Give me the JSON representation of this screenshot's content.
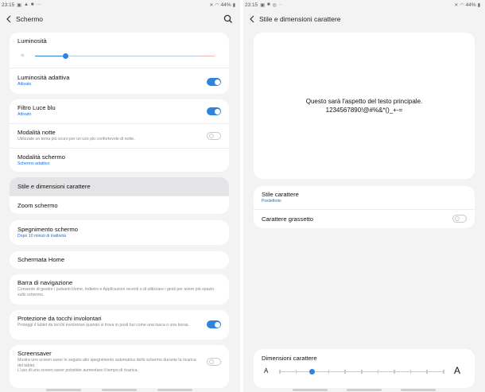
{
  "left": {
    "status": {
      "time": "23:15",
      "battery": "44%",
      "icons": [
        "gallery-icon",
        "warning-icon",
        "photo-icon",
        "more-icon"
      ]
    },
    "header": {
      "title": "Schermo"
    },
    "brightness": {
      "label": "Luminosità",
      "level": 0.17
    },
    "adaptive": {
      "title": "Luminosità adattiva",
      "status": "Attivato",
      "enabled": true
    },
    "blue_light": {
      "title": "Filtro Luce blu",
      "status": "Attivato",
      "enabled": true
    },
    "night_mode": {
      "title": "Modalità notte",
      "desc": "Utilizzate un tema più scuro per un uso più confortevole di notte.",
      "enabled": false
    },
    "screen_mode": {
      "title": "Modalità schermo",
      "status": "Schermo adattivo"
    },
    "font_style": {
      "title": "Stile e dimensioni carattere"
    },
    "zoom": {
      "title": "Zoom schermo"
    },
    "timeout": {
      "title": "Spegnimento schermo",
      "status": "Dopo 10 minuti di inattività"
    },
    "home": {
      "title": "Schermata Home"
    },
    "navbar": {
      "title": "Barra di navigazione",
      "desc": "Consente di gestire i pulsanti Home, Indietro e Applicazioni recenti o di utilizzare i gesti per avere più spazio sullo schermo."
    },
    "accidental": {
      "title": "Protezione da tocchi involontari",
      "desc": "Proteggi il tablet da tocchi involontari quando si trova in posti bui come una tasca o una borsa.",
      "enabled": true
    },
    "screensaver": {
      "title": "Screensaver",
      "desc1": "Mostra uno screen saver in seguito allo spegnimento automatico dello schermo durante la ricarica del tablet.",
      "desc2": "L'uso di uno screen saver potrebbe aumentare il tempo di ricarica.",
      "enabled": false
    }
  },
  "right": {
    "status": {
      "time": "23:15",
      "battery": "44%",
      "icons": [
        "gallery-icon",
        "photo-icon",
        "chrome-icon",
        "more-icon"
      ]
    },
    "header": {
      "title": "Stile e dimensioni carattere"
    },
    "preview": {
      "line1": "Questo sarà l'aspetto del testo principale.",
      "line2": "1234567890!@#%&*()_+-="
    },
    "font_style": {
      "title": "Stile carattere",
      "status": "Predefinito"
    },
    "bold": {
      "title": "Carattere grassetto",
      "enabled": false
    },
    "font_size": {
      "title": "Dimensioni carattere",
      "small_label": "A",
      "large_label": "A",
      "steps": 11,
      "selected_step": 2
    }
  },
  "colors": {
    "accent": "#2f83e0",
    "background": "#f3f3f4",
    "card": "#ffffff"
  }
}
